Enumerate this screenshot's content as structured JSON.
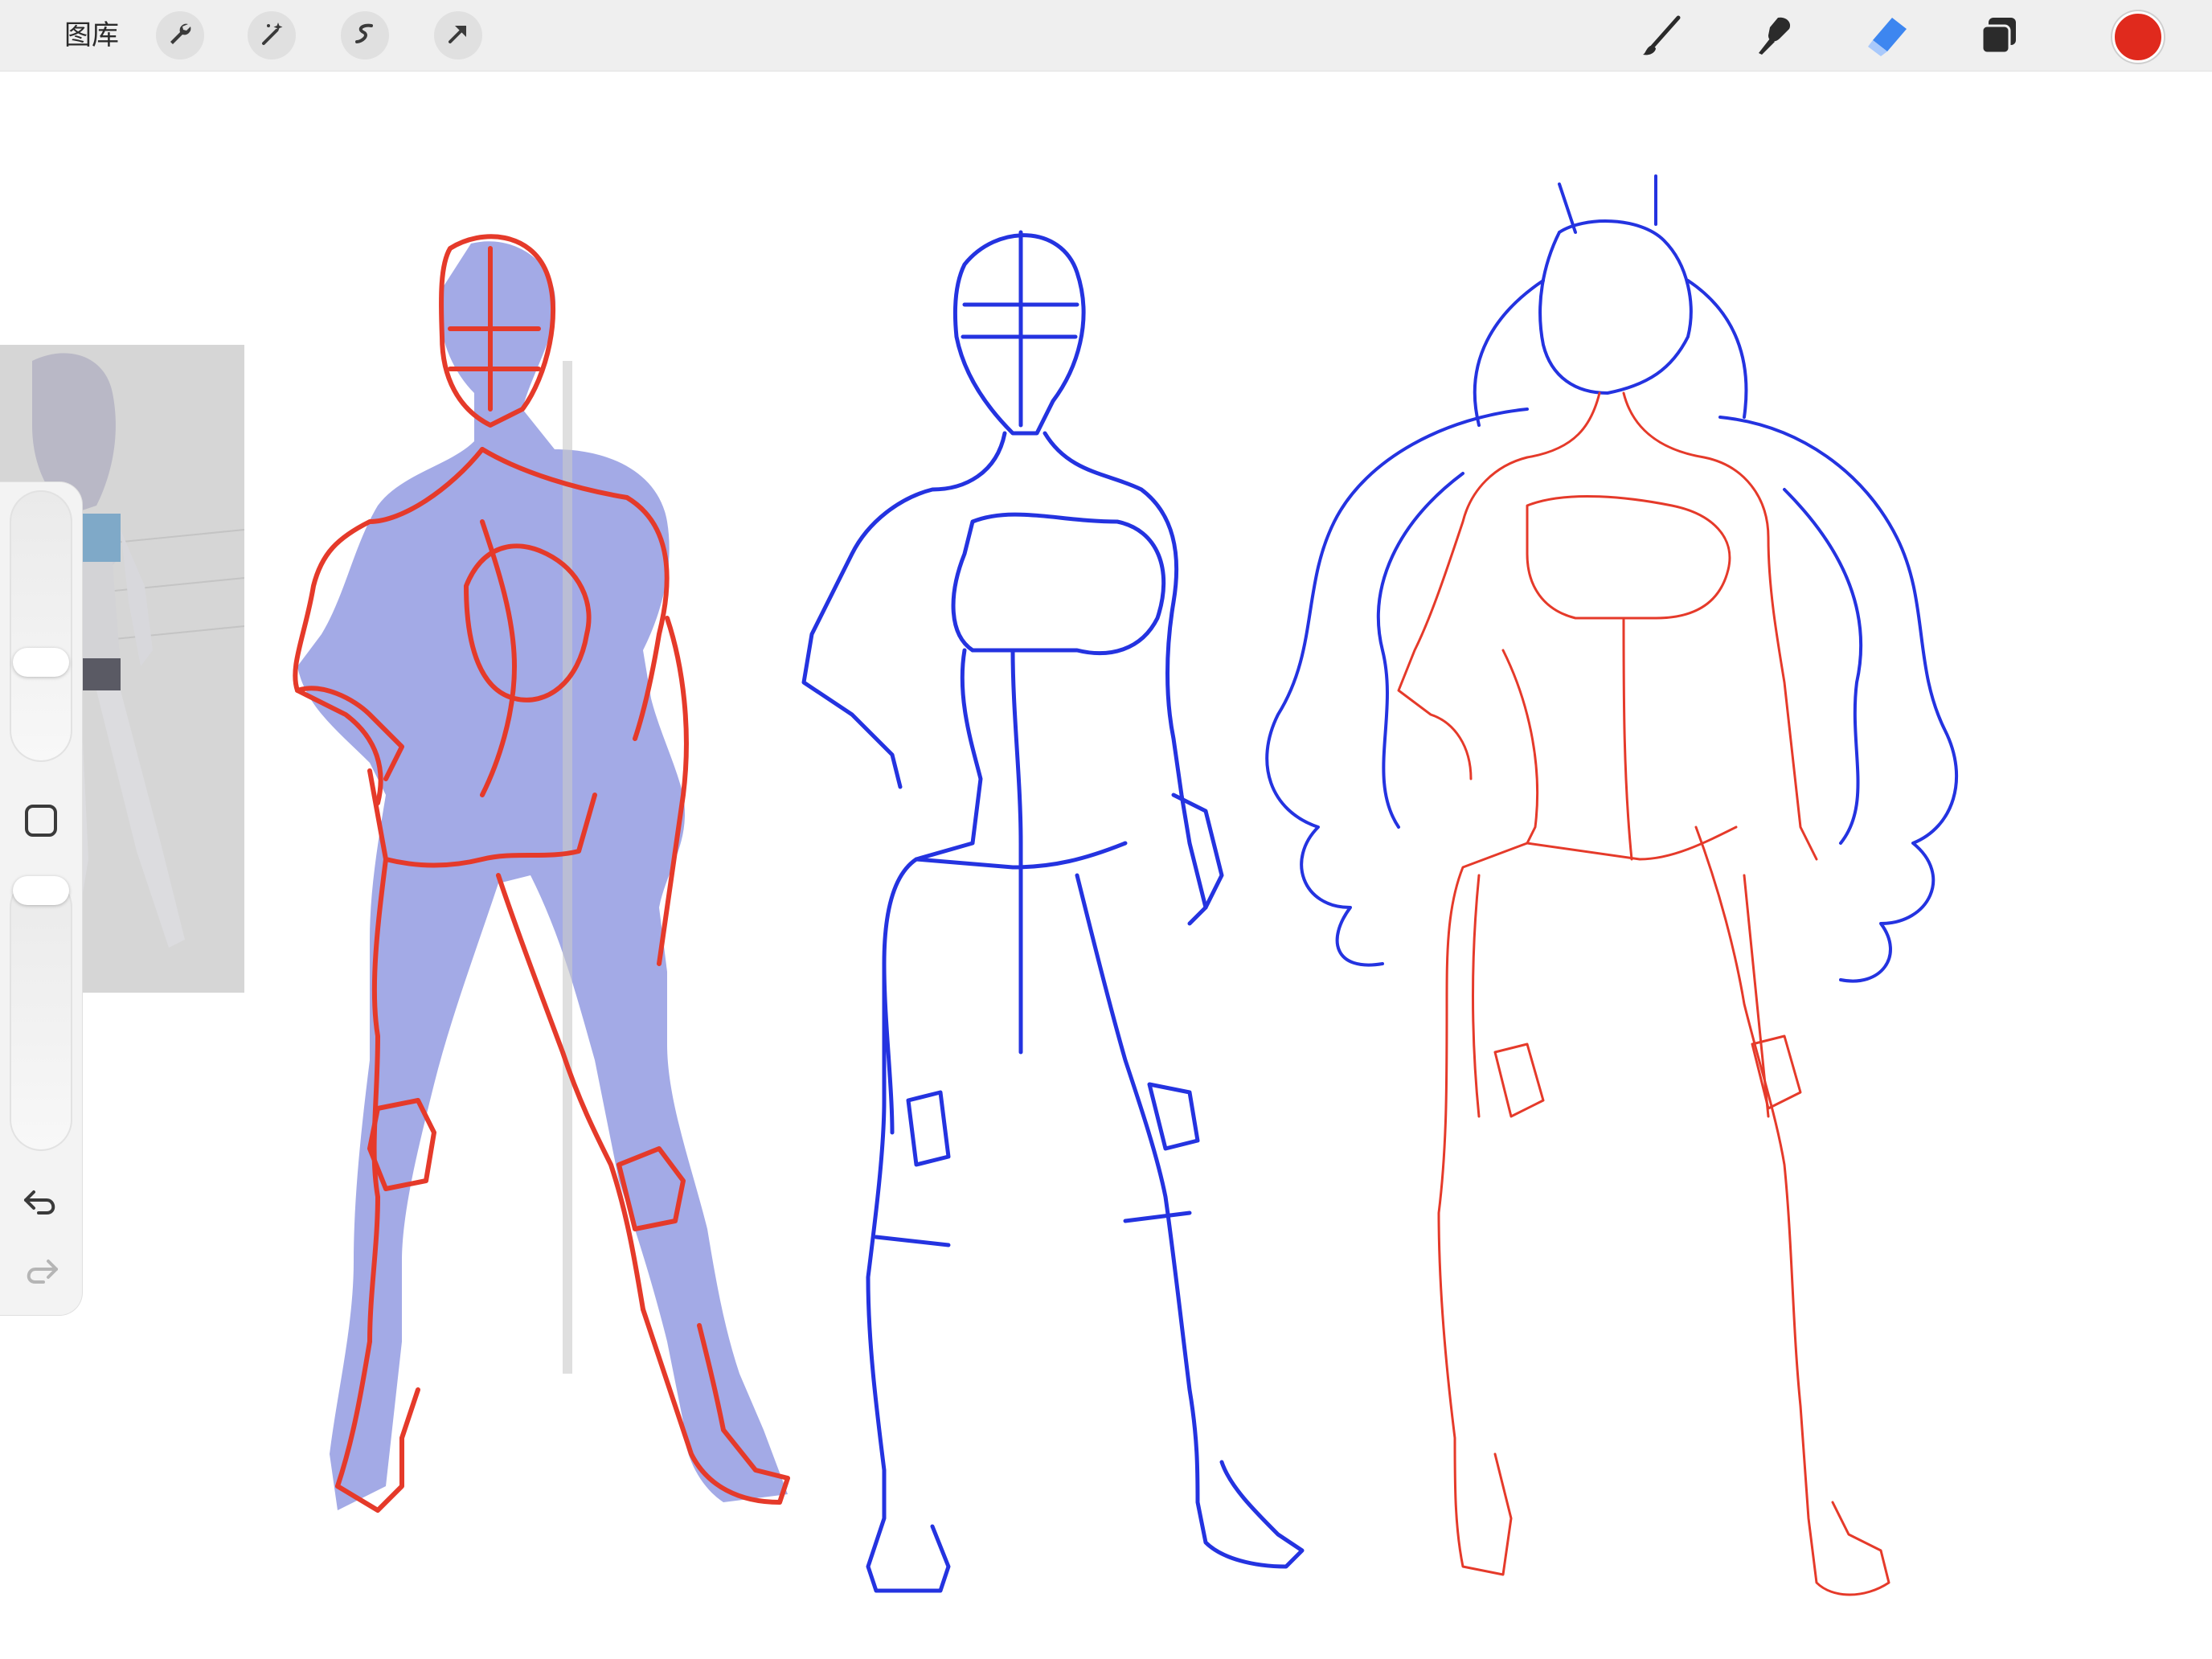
{
  "topbar": {
    "gallery_label": "图库",
    "left_tools": [
      "wrench-icon",
      "magic-wand-icon",
      "selection-icon",
      "transform-arrow-icon"
    ],
    "right_tools": [
      "brush-icon",
      "smudge-icon",
      "eraser-icon",
      "layers-icon"
    ],
    "current_color": "#e02a1d",
    "active_tool": "eraser",
    "active_tool_color": "#3d86f0"
  },
  "sidebar": {
    "icons": [
      "modify-square-icon",
      "undo-icon",
      "redo-icon"
    ],
    "brush_size_level": 0.58,
    "opacity_level": 0.0
  },
  "canvas": {
    "figures": [
      "red-sketch-over-blue-fill",
      "blue-structure-sketch",
      "red-anatomy-with-blue-hair"
    ],
    "stroke_colors": {
      "red": "#e53a2a",
      "blue": "#2433e0",
      "fill": "#a3aae6"
    }
  }
}
